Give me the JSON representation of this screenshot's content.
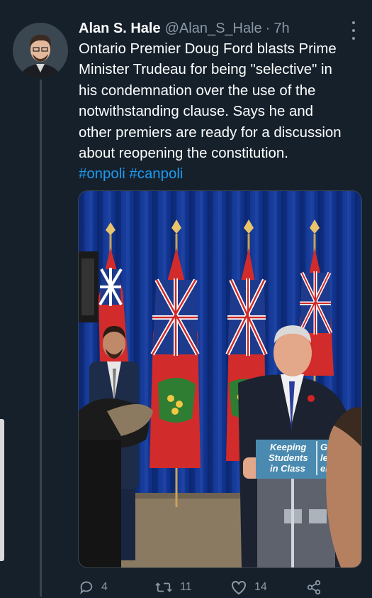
{
  "tweet": {
    "name": "Alan S. Hale",
    "handle": "@Alan_S_Hale",
    "separator": "·",
    "time": "7h",
    "text_lines": [
      "Ontario Premier Doug Ford blasts Prime",
      "Minister Trudeau for being \"selective\" in",
      "his condemnation over the use of the",
      "notwithstanding clause. Says he and",
      "other premiers are ready for a discussion",
      "about reopening the constitution."
    ],
    "hashtags": "#onpoli #canpoli"
  },
  "media": {
    "podium_sign_lines": [
      "Keeping",
      "Students",
      "in Class"
    ],
    "podium_sign_right_lines": [
      "Ga",
      "le",
      "el"
    ]
  },
  "actions": {
    "reply_count": "4",
    "retweet_count": "11",
    "like_count": "14"
  },
  "colors": {
    "background": "#15202b",
    "text": "#ffffff",
    "secondary": "#8b98a5",
    "link": "#1d9bf0"
  }
}
